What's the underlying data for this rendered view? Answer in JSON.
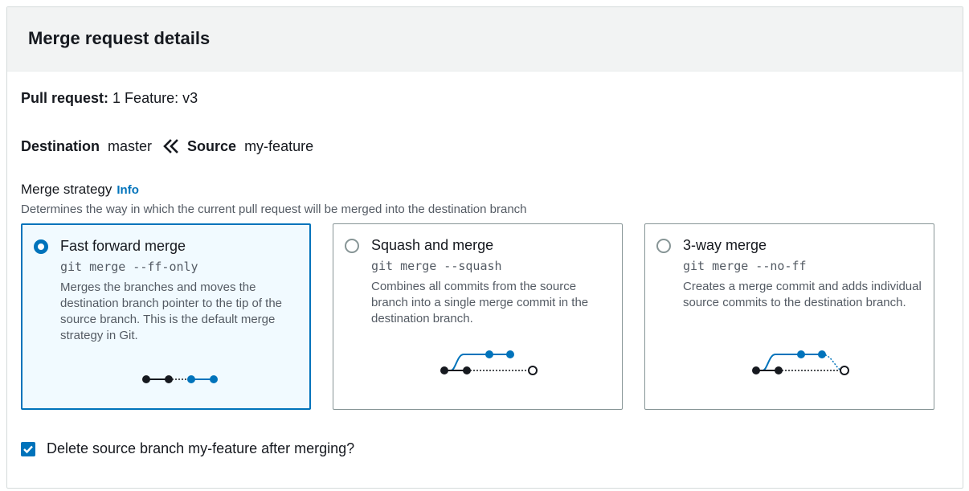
{
  "panel": {
    "title": "Merge request details"
  },
  "pull_request": {
    "label": "Pull request:",
    "value": "1 Feature: v3"
  },
  "branches": {
    "destination_label": "Destination",
    "destination_value": "master",
    "source_label": "Source",
    "source_value": "my-feature"
  },
  "strategy": {
    "label": "Merge strategy",
    "info_link": "Info",
    "description": "Determines the way in which the current pull request will be merged into the destination branch",
    "options": [
      {
        "title": "Fast forward merge",
        "command": "git merge --ff-only",
        "description": "Merges the branches and moves the destination branch pointer to the tip of the source branch. This is the default merge strategy in Git.",
        "selected": true
      },
      {
        "title": "Squash and merge",
        "command": "git merge --squash",
        "description": "Combines all commits from the source branch into a single merge commit in the destination branch.",
        "selected": false
      },
      {
        "title": "3-way merge",
        "command": "git merge --no-ff",
        "description": "Creates a merge commit and adds individual source commits to the destination branch.",
        "selected": false
      }
    ]
  },
  "delete_branch": {
    "label": "Delete source branch my-feature after merging?",
    "checked": true
  },
  "colors": {
    "accent": "#0073bb",
    "header_bg": "#f2f3f3",
    "selected_bg": "#f1faff",
    "border": "#879596"
  }
}
